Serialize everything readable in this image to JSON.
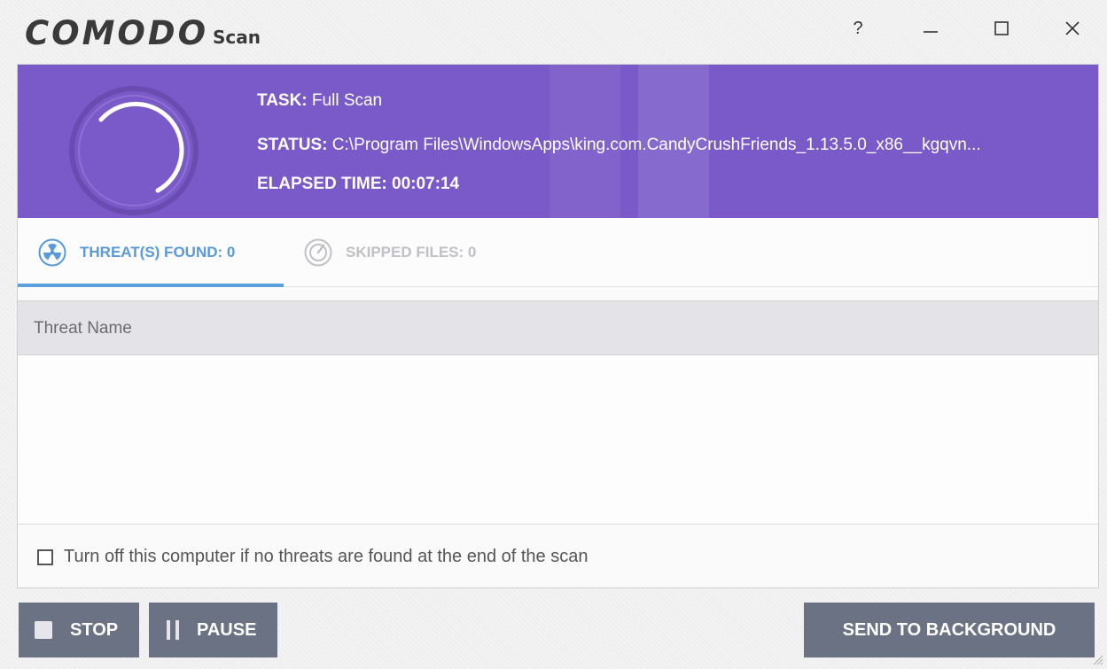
{
  "titlebar": {
    "brand": "COMODO",
    "app_name": "Scan",
    "help_label": "?",
    "icons": [
      "help-icon",
      "minimize-icon",
      "maximize-icon",
      "close-icon"
    ]
  },
  "banner": {
    "task_label": "TASK:",
    "task_value": "Full Scan",
    "status_label": "STATUS:",
    "status_value": "C:\\Program Files\\WindowsApps\\king.com.CandyCrushFriends_1.13.5.0_x86__kgqvn...",
    "elapsed_label": "ELAPSED TIME:",
    "elapsed_value": "00:07:14",
    "background_color": "#7a5ac8"
  },
  "tabs": [
    {
      "label": "THREAT(S) FOUND: 0",
      "icon": "radiation-icon",
      "active": true
    },
    {
      "label": "SKIPPED FILES: 0",
      "icon": "skip-disc-icon",
      "active": false
    }
  ],
  "table": {
    "columns": [
      "Threat Name"
    ],
    "rows": []
  },
  "options": {
    "shutdown_label": "Turn off this computer if no threats are found at the end of the scan",
    "shutdown_checked": false
  },
  "buttons": {
    "stop_label": "STOP",
    "pause_label": "PAUSE",
    "background_label": "SEND TO BACKGROUND"
  },
  "colors": {
    "accent_blue": "#5a9ad8",
    "button_gray": "#6b7283"
  }
}
